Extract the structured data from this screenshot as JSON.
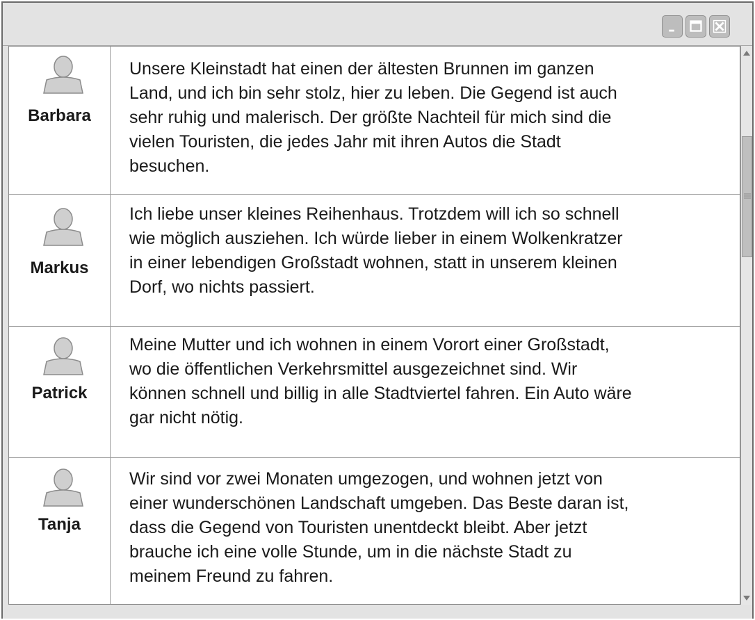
{
  "window": {
    "controls": [
      {
        "name": "minimize",
        "icon": "minimize-icon"
      },
      {
        "name": "maximize",
        "icon": "maximize-icon"
      },
      {
        "name": "close",
        "icon": "close-icon"
      }
    ]
  },
  "posts": [
    {
      "name": "Barbara",
      "avatar_icon": "user-avatar-icon",
      "text": "Unsere Kleinstadt hat einen der ältesten Brunnen im ganzen\nLand, und ich bin sehr stolz, hier zu leben.  Die Gegend ist auch\nsehr ruhig und malerisch. Der größte Nachteil für mich sind die\nvielen Touristen, die jedes Jahr mit ihren Autos die Stadt\nbesuchen."
    },
    {
      "name": "Markus",
      "avatar_icon": "user-avatar-icon",
      "text": "Ich liebe unser kleines Reihenhaus. Trotzdem will ich so schnell\nwie möglich ausziehen. Ich würde lieber in einem Wolkenkratzer\nin einer lebendigen Großstadt wohnen, statt in unserem kleinen\nDorf, wo nichts passiert."
    },
    {
      "name": "Patrick",
      "avatar_icon": "user-avatar-icon",
      "text": "Meine Mutter und ich wohnen in einem Vorort einer Großstadt,\nwo die öffentlichen Verkehrsmittel ausgezeichnet sind. Wir\nkönnen schnell und billig in alle Stadtviertel fahren. Ein Auto wäre\ngar nicht nötig."
    },
    {
      "name": "Tanja",
      "avatar_icon": "user-avatar-icon",
      "text": "Wir sind vor zwei Monaten umgezogen, und wohnen jetzt von\neiner wunderschönen Landschaft umgeben. Das Beste daran ist,\ndass die Gegend von Touristen unentdeckt bleibt. Aber jetzt\nbrauche ich eine volle Stunde, um in die nächste Stadt zu\nmeinem Freund zu fahren."
    }
  ],
  "scrollbar": {
    "position_fraction": 0.17,
    "icons": [
      "scroll-up-arrow-icon",
      "scroll-down-arrow-icon",
      "grip-icon"
    ]
  },
  "colors": {
    "window_chrome": "#e3e3e3",
    "button_face": "#bdbdbd",
    "border": "#6b6b6b",
    "text": "#1a1a1a"
  }
}
